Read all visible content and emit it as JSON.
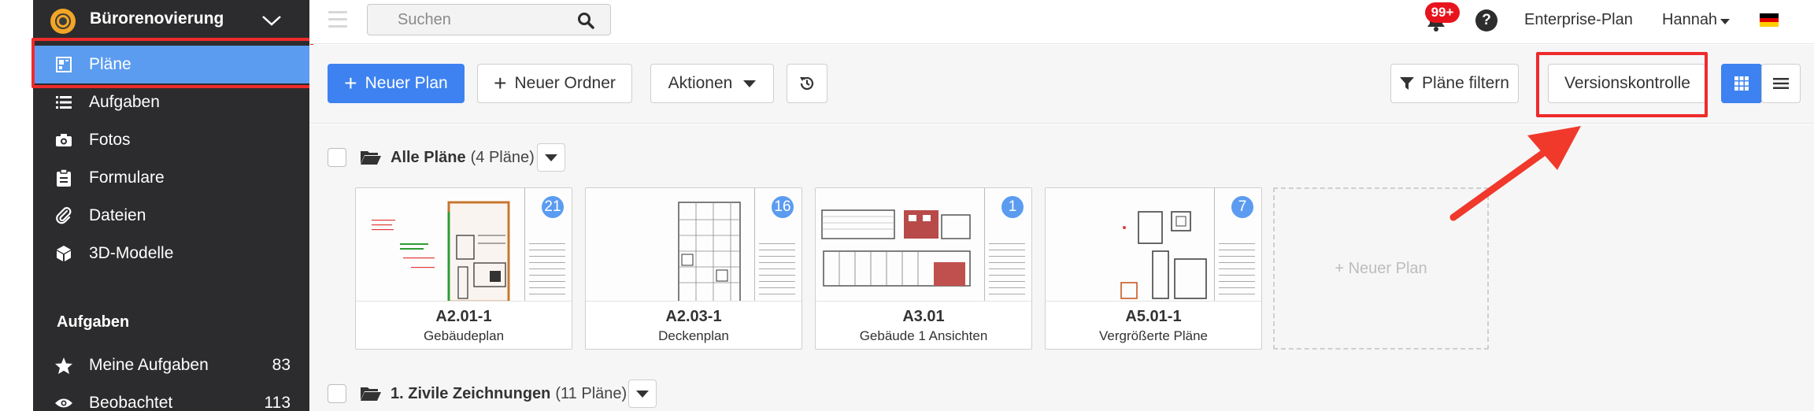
{
  "sidebar": {
    "project_name": "Bürorenovierung",
    "items": [
      {
        "label": "Pläne",
        "icon": "plans-icon",
        "active": true
      },
      {
        "label": "Aufgaben",
        "icon": "list-icon"
      },
      {
        "label": "Fotos",
        "icon": "camera-icon"
      },
      {
        "label": "Formulare",
        "icon": "clipboard-icon"
      },
      {
        "label": "Dateien",
        "icon": "paperclip-icon"
      },
      {
        "label": "3D-Modelle",
        "icon": "cube-icon"
      }
    ],
    "tasks_section": {
      "title": "Aufgaben",
      "items": [
        {
          "label": "Meine Aufgaben",
          "count": "83",
          "icon": "star-icon"
        },
        {
          "label": "Beobachtet",
          "count": "113",
          "icon": "eye-icon"
        }
      ]
    }
  },
  "topbar": {
    "search_placeholder": "Suchen",
    "notifications_badge": "99+",
    "help_label": "?",
    "plan_link": "Enterprise-Plan",
    "user_name": "Hannah"
  },
  "toolbar": {
    "new_plan": "Neuer Plan",
    "new_folder": "Neuer Ordner",
    "actions": "Aktionen",
    "filter": "Pläne filtern",
    "version_control": "Versionskontrolle"
  },
  "folders": [
    {
      "name": "Alle Pläne",
      "count_text": "(4 Pläne)",
      "plans": [
        {
          "number": "A2.01-1",
          "title": "Gebäudeplan",
          "badge": "21"
        },
        {
          "number": "A2.03-1",
          "title": "Deckenplan",
          "badge": "16"
        },
        {
          "number": "A3.01",
          "title": "Gebäude 1 Ansichten",
          "badge": "1"
        },
        {
          "number": "A5.01-1",
          "title": "Vergrößerte Pläne",
          "badge": "7"
        }
      ],
      "new_plan_label": "+ Neuer Plan"
    },
    {
      "name": "1. Zivile Zeichnungen",
      "count_text": "(11 Pläne)"
    }
  ],
  "colors": {
    "sidebar_bg": "#2c2c2e",
    "active_item": "#5b9cf0",
    "primary_button": "#3d82f0",
    "highlight_red": "#ee2b2b",
    "badge_blue": "#5b9cf0",
    "notification_red": "#e8141d"
  }
}
